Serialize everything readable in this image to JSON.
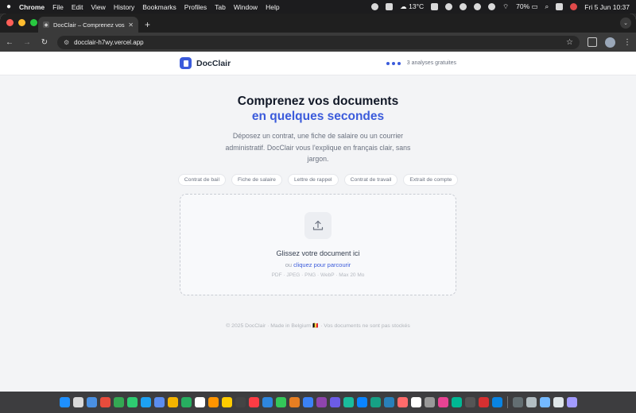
{
  "menubar": {
    "app": "Chrome",
    "items": [
      "File",
      "Edit",
      "View",
      "History",
      "Bookmarks",
      "Profiles",
      "Tab",
      "Window",
      "Help"
    ],
    "weather": "13°C",
    "battery": "70%",
    "datetime": "Fri 5 Jun  10:37"
  },
  "browser": {
    "tab_title": "DocClair – Comprenez vos d",
    "url": "docclair-h7wy.vercel.app"
  },
  "site": {
    "brand": "DocClair",
    "free_analyses": "3 analyses gratuites",
    "brand_color": "#3b5bdb"
  },
  "hero": {
    "title_line1": "Comprenez vos documents",
    "title_line2": "en quelques secondes",
    "subtitle": "Déposez un contrat, une fiche de salaire ou un courrier administratif. DocClair vous l'explique en français clair, sans jargon."
  },
  "chips": [
    "Contrat de bail",
    "Fiche de salaire",
    "Lettre de rappel",
    "Contrat de travail",
    "Extrait de compte"
  ],
  "dropzone": {
    "title": "Glissez votre document ici",
    "or_text": "ou",
    "browse_link": "cliquez pour parcourir",
    "formats": "PDF · JPEG · PNG · WebP · Max 20 Mo"
  },
  "footer": {
    "text": "© 2025 DocClair · Made in Belgium 🇧🇪 · Vos documents ne sont pas stockés"
  },
  "dock_colors": [
    "#1e90ff",
    "#d9d9d9",
    "#4a90e2",
    "#e74c3c",
    "#34a853",
    "#2ecc71",
    "#1da1f2",
    "#5b8def",
    "#f4b400",
    "#27ae60",
    "#ffffff",
    "#ff9500",
    "#ffcc00",
    "#444444",
    "#fc3c44",
    "#2e86de",
    "#34c759",
    "#e67e22",
    "#3b82f6",
    "#8e44ad",
    "#6c5ce7",
    "#1abc9c",
    "#0a84ff",
    "#16a085",
    "#2980b9",
    "#ff6b6b",
    "#ffffff",
    "#999999",
    "#e84393",
    "#00b894",
    "#555555",
    "#d63031",
    "#0984e3",
    "#636e72",
    "#b2bec3",
    "#74b9ff",
    "#dfe6e9",
    "#a29bfe"
  ]
}
